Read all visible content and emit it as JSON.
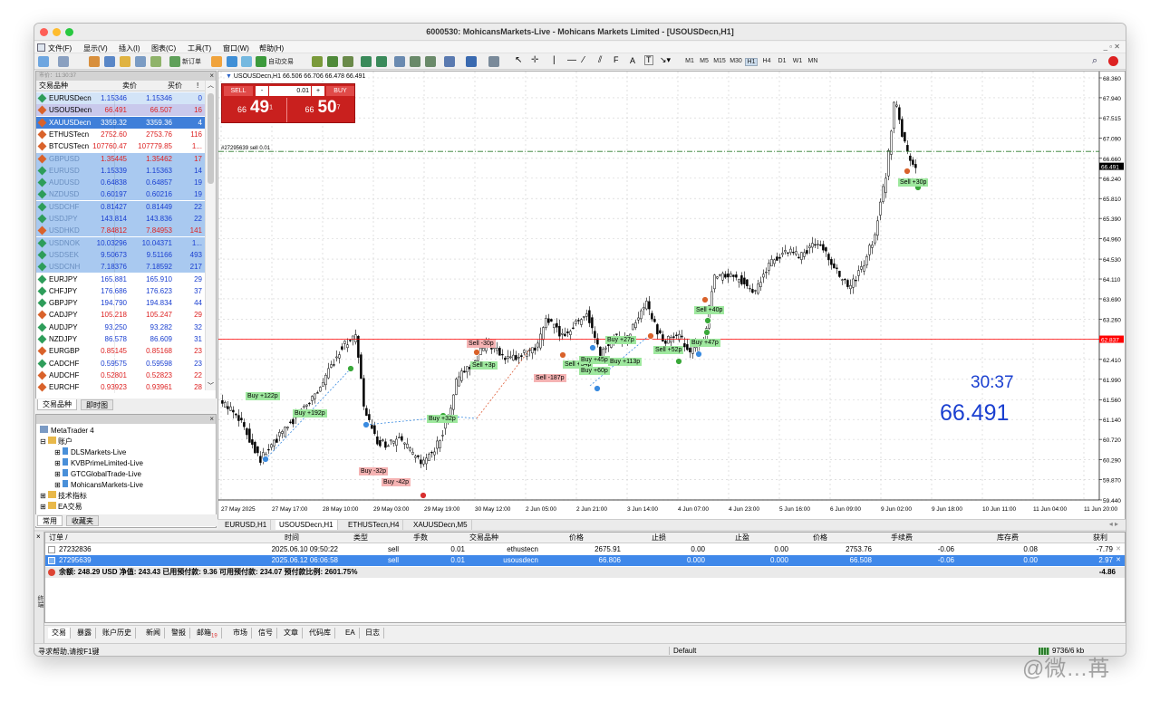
{
  "window": {
    "title": "6000530: MohicansMarkets-Live - Mohicans Markets Limited - [USOUSDecn,H1]"
  },
  "menu": [
    "文件(F)",
    "显示(V)",
    "插入(I)",
    "图表(C)",
    "工具(T)",
    "窗口(W)",
    "帮助(H)"
  ],
  "toolbar": {
    "new_order": "新订单",
    "auto_trade": "自动交易",
    "timeframes": [
      "M1",
      "M5",
      "M15",
      "M30",
      "H1",
      "H4",
      "D1",
      "W1",
      "MN"
    ]
  },
  "market_watch": {
    "header": "市价：11:30:37",
    "cols": [
      "交易品种",
      "卖价",
      "买价",
      "!"
    ],
    "rows": [
      {
        "symbol": "EURUSDecn",
        "bid": "1.15346",
        "ask": "1.15346",
        "spread": "0",
        "bg": "#d3e4f7",
        "dir": "up"
      },
      {
        "symbol": "USOUSDecn",
        "bid": "66.491",
        "ask": "66.507",
        "spread": "16",
        "bg": "#c9c9ec",
        "dir": "dn"
      },
      {
        "symbol": "XAUUSDecn",
        "bid": "3359.32",
        "ask": "3359.36",
        "spread": "4",
        "bg": "#3f7fd9",
        "dir": "dn",
        "fg": "#ffffff"
      },
      {
        "symbol": "ETHUSTecn",
        "bid": "2752.60",
        "ask": "2753.76",
        "spread": "116",
        "bg": "#ffffff",
        "dir": "dn"
      },
      {
        "symbol": "BTCUSTecn",
        "bid": "107760.47",
        "ask": "107779.85",
        "spread": "1...",
        "bg": "#ffffff",
        "dir": "dn"
      },
      {
        "symbol": "GBPUSD",
        "bid": "1.35445",
        "ask": "1.35462",
        "spread": "17",
        "bg": "#a9c9f0",
        "dir": "dn",
        "faded": true
      },
      {
        "symbol": "EURUSD",
        "bid": "1.15339",
        "ask": "1.15363",
        "spread": "14",
        "bg": "#a9c9f0",
        "dir": "up",
        "faded": true
      },
      {
        "symbol": "AUDUSD",
        "bid": "0.64838",
        "ask": "0.64857",
        "spread": "19",
        "bg": "#a9c9f0",
        "dir": "up",
        "faded": true
      },
      {
        "symbol": "NZDUSD",
        "bid": "0.60197",
        "ask": "0.60216",
        "spread": "19",
        "bg": "#a9c9f0",
        "dir": "up",
        "faded": true
      },
      {
        "symbol": "USDCHF",
        "bid": "0.81427",
        "ask": "0.81449",
        "spread": "22",
        "bg": "#a9c9f0",
        "dir": "up",
        "faded": true
      },
      {
        "symbol": "USDJPY",
        "bid": "143.814",
        "ask": "143.836",
        "spread": "22",
        "bg": "#a9c9f0",
        "dir": "up",
        "faded": true
      },
      {
        "symbol": "USDHKD",
        "bid": "7.84812",
        "ask": "7.84953",
        "spread": "141",
        "bg": "#a9c9f0",
        "dir": "dn",
        "faded": true
      },
      {
        "symbol": "USDNOK",
        "bid": "10.03296",
        "ask": "10.04371",
        "spread": "1...",
        "bg": "#a9c9f0",
        "dir": "up",
        "faded": true
      },
      {
        "symbol": "USDSEK",
        "bid": "9.50673",
        "ask": "9.51166",
        "spread": "493",
        "bg": "#a9c9f0",
        "dir": "up",
        "faded": true
      },
      {
        "symbol": "USDCNH",
        "bid": "7.18376",
        "ask": "7.18592",
        "spread": "217",
        "bg": "#a9c9f0",
        "dir": "up",
        "faded": true
      },
      {
        "symbol": "EURJPY",
        "bid": "165.881",
        "ask": "165.910",
        "spread": "29",
        "bg": "#ffffff",
        "dir": "up"
      },
      {
        "symbol": "CHFJPY",
        "bid": "176.686",
        "ask": "176.623",
        "spread": "37",
        "bg": "#ffffff",
        "dir": "up"
      },
      {
        "symbol": "GBPJPY",
        "bid": "194.790",
        "ask": "194.834",
        "spread": "44",
        "bg": "#ffffff",
        "dir": "up"
      },
      {
        "symbol": "CADJPY",
        "bid": "105.218",
        "ask": "105.247",
        "spread": "29",
        "bg": "#ffffff",
        "dir": "dn"
      },
      {
        "symbol": "AUDJPY",
        "bid": "93.250",
        "ask": "93.282",
        "spread": "32",
        "bg": "#ffffff",
        "dir": "up"
      },
      {
        "symbol": "NZDJPY",
        "bid": "86.578",
        "ask": "86.609",
        "spread": "31",
        "bg": "#ffffff",
        "dir": "up"
      },
      {
        "symbol": "EURGBP",
        "bid": "0.85145",
        "ask": "0.85168",
        "spread": "23",
        "bg": "#ffffff",
        "dir": "dn"
      },
      {
        "symbol": "CADCHF",
        "bid": "0.59575",
        "ask": "0.59598",
        "spread": "23",
        "bg": "#ffffff",
        "dir": "up"
      },
      {
        "symbol": "AUDCHF",
        "bid": "0.52801",
        "ask": "0.52823",
        "spread": "22",
        "bg": "#ffffff",
        "dir": "dn"
      },
      {
        "symbol": "EURCHF",
        "bid": "0.93923",
        "ask": "0.93961",
        "spread": "28",
        "bg": "#ffffff",
        "dir": "dn"
      }
    ],
    "tabs": [
      "交易品种",
      "即时图"
    ]
  },
  "navigator": {
    "items": [
      "MetaTrader 4",
      "账户",
      "DLSMarkets-Live",
      "KVBPrimeLimited-Live",
      "GTCGlobalTrade-Live",
      "MohicansMarkets-Live",
      "技术指标",
      "EA交易"
    ],
    "tabs": [
      "常用",
      "收藏夹"
    ]
  },
  "chart": {
    "symbol_info": "USOUSDecn,H1  66.506 66.706 66.478 66.491",
    "one_click": {
      "sell": "SELL",
      "buy": "BUY",
      "lot": "0.01",
      "sell_pre": "66",
      "sell_big": "49",
      "sell_sup": "1",
      "buy_pre": "66",
      "buy_big": "50",
      "buy_sup": "7"
    },
    "order_line_label": "#27295639 sell 0.01",
    "countdown": "30:37",
    "big_price": "66.491",
    "price_axis": [
      "68.360",
      "67.940",
      "67.515",
      "67.090",
      "66.660",
      "66.240",
      "65.810",
      "65.390",
      "64.960",
      "64.530",
      "64.110",
      "63.690",
      "63.260",
      "62.837",
      "62.410",
      "61.990",
      "61.560",
      "61.140",
      "60.720",
      "60.290",
      "59.870",
      "59.440"
    ],
    "current_price_tag": "66.491",
    "red_line_tag": "62.837",
    "time_axis": [
      "27 May 2025",
      "27 May 17:00",
      "28 May 10:00",
      "29 May 03:00",
      "29 May 19:00",
      "30 May 12:00",
      "2 Jun 05:00",
      "2 Jun 21:00",
      "3 Jun 14:00",
      "4 Jun 07:00",
      "4 Jun 23:00",
      "5 Jun 16:00",
      "6 Jun 09:00",
      "9 Jun 02:00",
      "9 Jun 18:00",
      "10 Jun 11:00",
      "11 Jun 04:00",
      "11 Jun 20:00"
    ],
    "trade_labels": [
      {
        "text": "Buy +122p",
        "kind": "buy"
      },
      {
        "text": "Buy +192p",
        "kind": "buy"
      },
      {
        "text": "Buy -32p",
        "kind": "sell"
      },
      {
        "text": "Buy -42p",
        "kind": "sell"
      },
      {
        "text": "Buy +32p",
        "kind": "buy"
      },
      {
        "text": "Sell -30p",
        "kind": "sell"
      },
      {
        "text": "Sell +3p",
        "kind": "buy"
      },
      {
        "text": "Sell -187p",
        "kind": "sell"
      },
      {
        "text": "Sell +34p",
        "kind": "buy"
      },
      {
        "text": "Buy +45p",
        "kind": "buy"
      },
      {
        "text": "Buy +60p",
        "kind": "buy"
      },
      {
        "text": "Buy +27p",
        "kind": "buy"
      },
      {
        "text": "Buy +113p",
        "kind": "buy"
      },
      {
        "text": "Sell +52p",
        "kind": "buy"
      },
      {
        "text": "Sell +40p",
        "kind": "buy"
      },
      {
        "text": "Buy +47p",
        "kind": "buy"
      },
      {
        "text": "Sell +30p",
        "kind": "buy"
      }
    ]
  },
  "chart_tabs": [
    "EURUSD,H1",
    "USOUSDecn,H1",
    "ETHUSTecn,H4",
    "XAUUSDecn,M5"
  ],
  "terminal": {
    "cols": [
      "订单 /",
      "时间",
      "类型",
      "手数",
      "交易品种",
      "价格",
      "止损",
      "止盈",
      "价格",
      "手续费",
      "库存费",
      "获利"
    ],
    "rows": [
      [
        "27232836",
        "2025.06.10 09:50:22",
        "sell",
        "0.01",
        "ethustecn",
        "2675.91",
        "0.00",
        "0.00",
        "2753.76",
        "-0.06",
        "0.08",
        "-7.79"
      ],
      [
        "27295639",
        "2025.06.12 06:06:58",
        "sell",
        "0.01",
        "usousdecn",
        "66.806",
        "0.000",
        "0.000",
        "66.508",
        "-0.06",
        "0.00",
        "2.97"
      ]
    ],
    "balance": "余额: 248.29 USD  净值: 243.43  已用预付款: 9.36  可用预付款: 234.07  预付款比例: 2601.75%",
    "balance_total": "-4.86",
    "tabs": [
      "交易",
      "暴露",
      "账户历史",
      "新闻",
      "警报",
      "邮箱",
      "市场",
      "信号",
      "文章",
      "代码库",
      "EA",
      "日志"
    ],
    "mail_count": "19"
  },
  "status": {
    "help": "寻求帮助,请按F1键",
    "profile": "Default",
    "traffic": "9736/6 kb"
  },
  "watermark": "@微…苒",
  "colors": {
    "bull": "#000000",
    "bear": "#000000",
    "ask_line": "#ff0000",
    "grid": "#c8c8c8",
    "sell_btn": "#c9201e",
    "selected": "#3f88ea"
  }
}
